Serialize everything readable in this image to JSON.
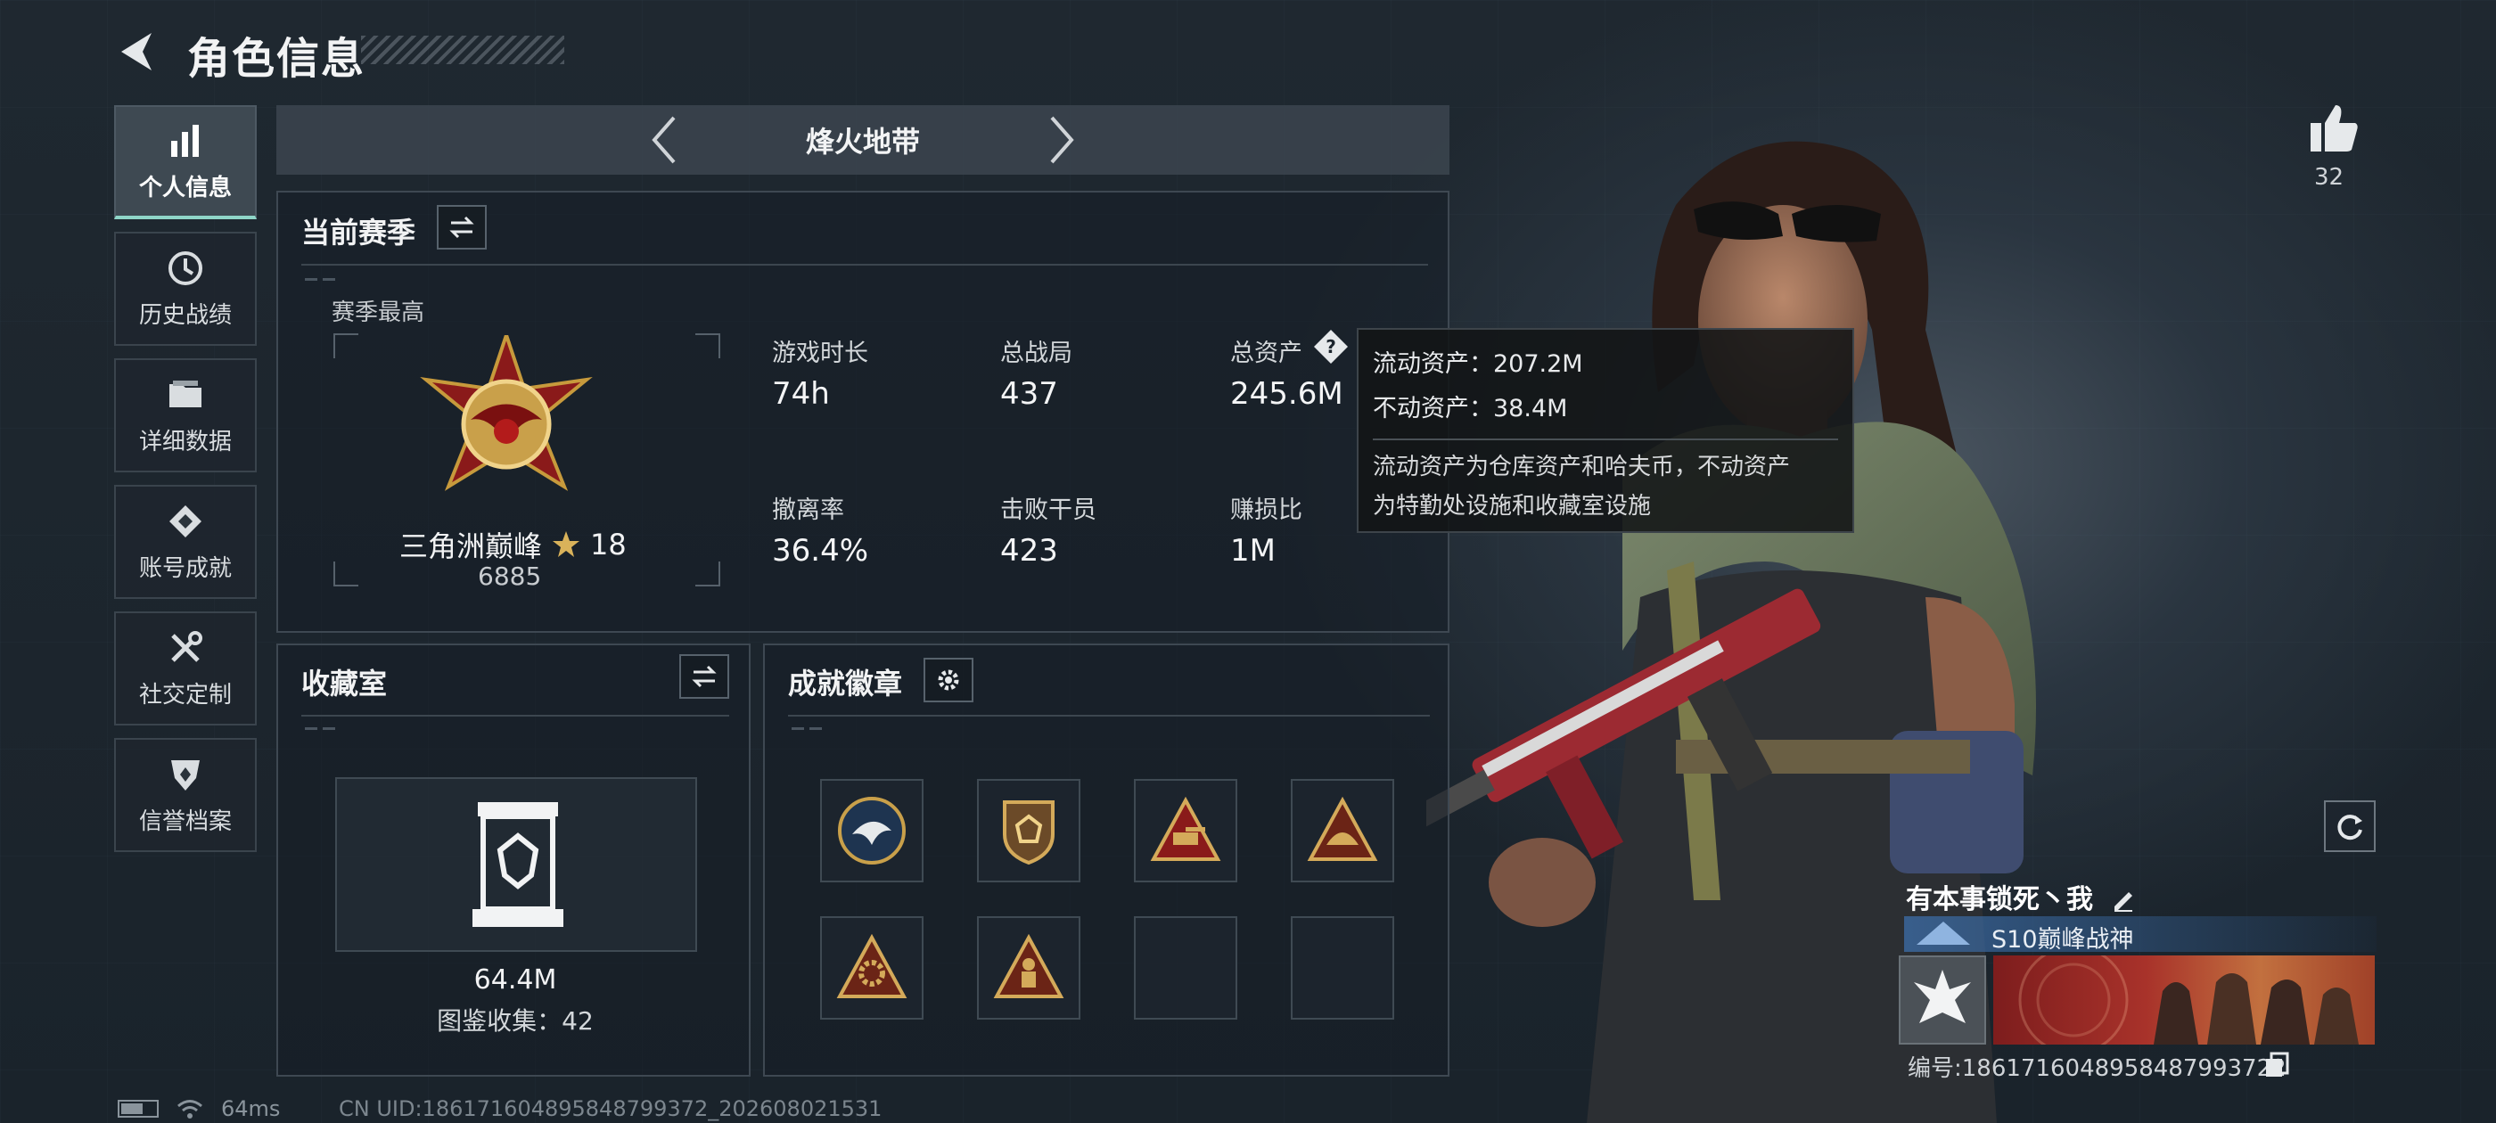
{
  "header": {
    "title": "角色信息"
  },
  "sidebar": {
    "items": [
      {
        "label": "个人信息",
        "icon": "bar-chart-icon",
        "active": true
      },
      {
        "label": "历史战绩",
        "icon": "clock-icon",
        "active": false
      },
      {
        "label": "详细数据",
        "icon": "folder-icon",
        "active": false
      },
      {
        "label": "账号成就",
        "icon": "achievement-icon",
        "active": false
      },
      {
        "label": "社交定制",
        "icon": "tools-icon",
        "active": false
      },
      {
        "label": "信誉档案",
        "icon": "shield-icon",
        "active": false
      }
    ]
  },
  "mode": {
    "label": "烽火地带"
  },
  "season": {
    "title": "当前赛季",
    "subtitle": "赛季最高",
    "rank_name": "三角洲巅峰",
    "rank_stars": "18",
    "rank_score": "6885",
    "stats": [
      {
        "label": "游戏时长",
        "value": "74h"
      },
      {
        "label": "总战局",
        "value": "437"
      },
      {
        "label": "总资产",
        "value": "245.6M"
      },
      {
        "label": "撤离率",
        "value": "36.4%"
      },
      {
        "label": "击败干员",
        "value": "423"
      },
      {
        "label": "赚损比",
        "value": "1M"
      }
    ]
  },
  "tooltip": {
    "liquid": "流动资产：207.2M",
    "fixed": "不动资产：38.4M",
    "desc_line1": "流动资产为仓库资产和哈夫币，不动资产",
    "desc_line2": "为特勤处设施和收藏室设施"
  },
  "collection": {
    "title": "收藏室",
    "value": "64.4M",
    "catalog": "图鉴收集：42"
  },
  "badges": {
    "title": "成就徽章",
    "items": [
      "eagle-badge-icon",
      "shield-badge-icon",
      "tank-badge-icon",
      "helmet-badge-icon",
      "gear-badge-icon",
      "soldier-badge-icon",
      "",
      ""
    ]
  },
  "profile": {
    "likes": "32",
    "player_name": "有本事锁死丶我",
    "title": "S10巅峰战神",
    "id_label": "编号:1861716048958487993722"
  },
  "status_bar": {
    "ping": "64ms",
    "uid": "CN UID:186171604895848799372_202608021531"
  },
  "colors": {
    "accent": "#8fd6c8",
    "background": "#1b242c",
    "panel_border": "#3e4852"
  }
}
